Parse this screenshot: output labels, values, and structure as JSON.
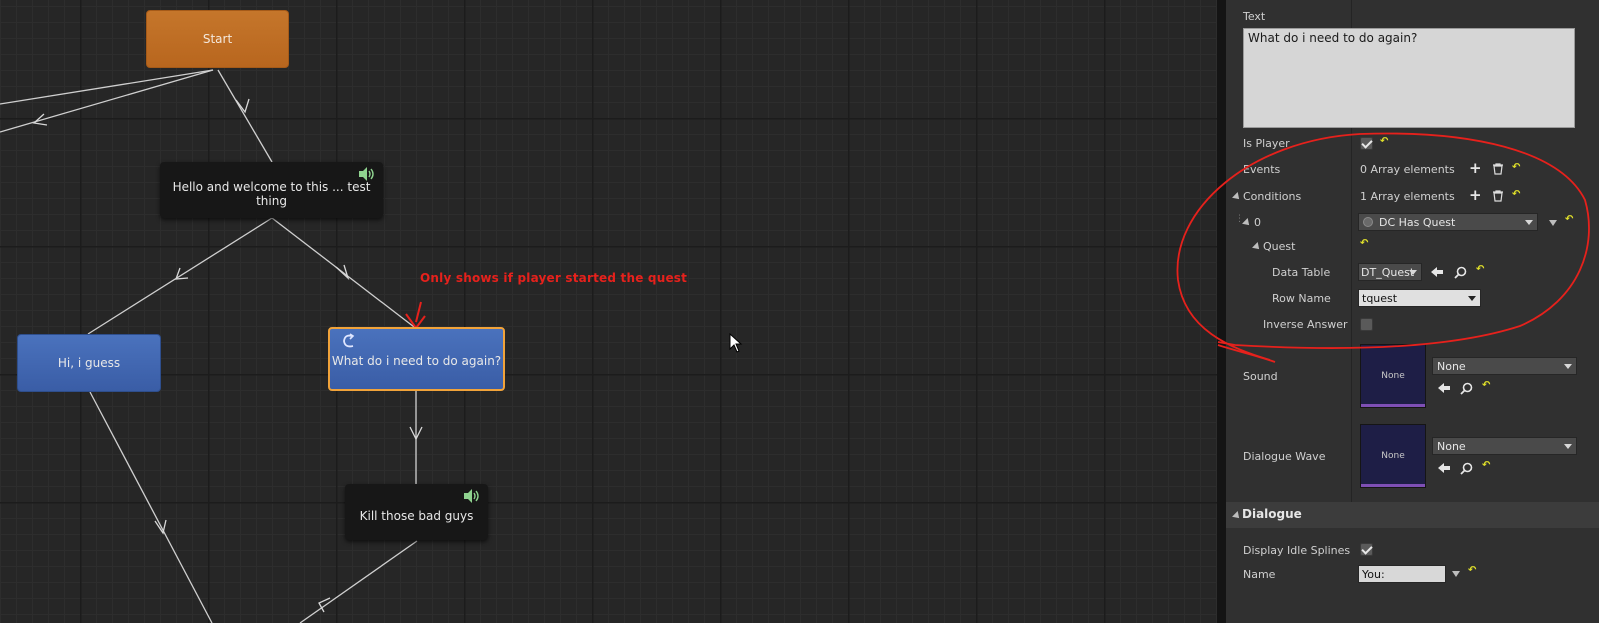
{
  "graph": {
    "nodes": {
      "start": "Start",
      "hello": "Hello and welcome to this ... test thing",
      "hi": "Hi, i guess",
      "what": "What do i need to do again?",
      "kill": "Kill those bad guys"
    },
    "annotation": "Only shows if player started the quest"
  },
  "details": {
    "text_label": "Text",
    "text_value": "What do i need to do again?",
    "is_player_label": "Is Player",
    "events_label": "Events",
    "events_value": "0 Array elements",
    "conditions_label": "Conditions",
    "conditions_value": "1 Array elements",
    "index0_label": "0",
    "condition_type": "DC Has Quest",
    "quest_label": "Quest",
    "data_table_label": "Data Table",
    "data_table_value": "DT_Quest",
    "row_name_label": "Row Name",
    "row_name_value": "tquest",
    "inverse_label": "Inverse Answer",
    "sound_label": "Sound",
    "sound_thumb": "None",
    "sound_value": "None",
    "wave_label": "Dialogue Wave",
    "wave_thumb": "None",
    "wave_value": "None",
    "dialogue_section": "Dialogue",
    "display_idle_label": "Display Idle Splines",
    "name_label": "Name",
    "name_value": "You:"
  },
  "colors": {
    "annotation_red": "#e6211c",
    "start_node": "#c5762b",
    "player_node": "#4a72bd",
    "selected_outline": "#f1a33a"
  },
  "icons": [
    "speaker-icon",
    "loop-icon",
    "plus-icon",
    "trash-icon",
    "reset-arrow-icon",
    "back-arrow-icon",
    "search-icon",
    "dropdown-caret-icon",
    "cursor-icon"
  ]
}
